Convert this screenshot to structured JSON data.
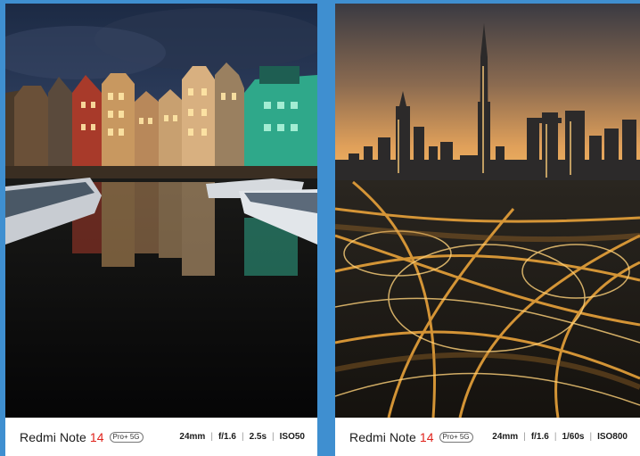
{
  "left_card": {
    "brand": {
      "name": "Redmi Note",
      "model_number": "14",
      "badge": "Pro+ 5G"
    },
    "specs": {
      "focal_length": "24mm",
      "aperture": "f/1.6",
      "shutter": "2.5s",
      "iso": "ISO50"
    },
    "separator": "|"
  },
  "right_card": {
    "brand": {
      "name": "Redmi Note",
      "model_number": "14",
      "badge": "Pro+ 5G"
    },
    "specs": {
      "focal_length": "24mm",
      "aperture": "f/1.6",
      "shutter": "1/60s",
      "iso": "ISO800"
    },
    "separator": "|"
  },
  "colors": {
    "background": "#3f8fd0",
    "accent_red": "#e0231c"
  }
}
